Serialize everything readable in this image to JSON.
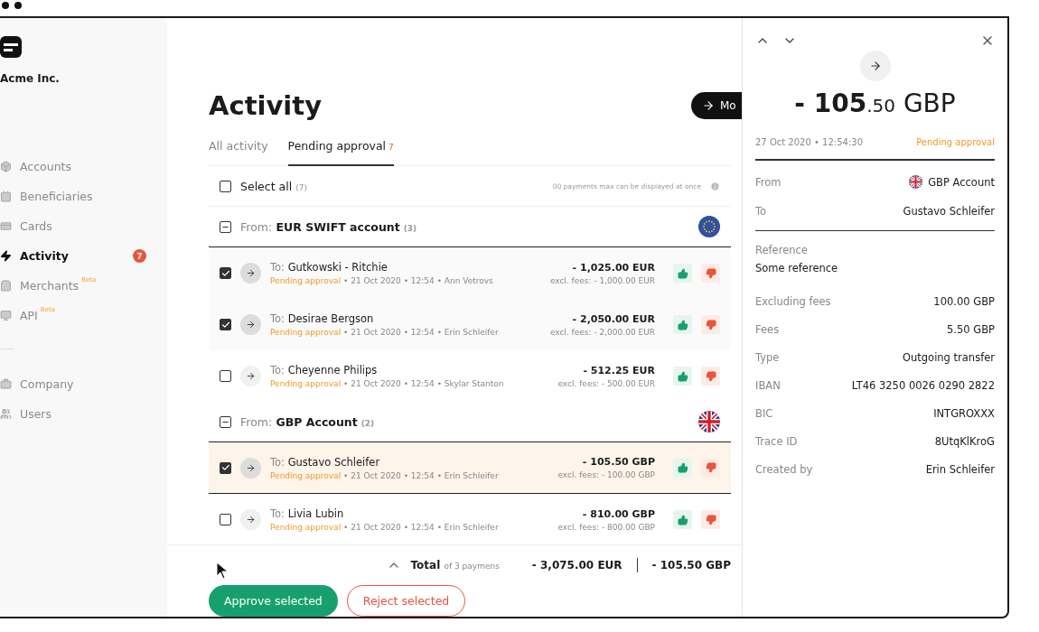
{
  "sidebar": {
    "company": "Acme Inc.",
    "items": [
      {
        "label": "Accounts",
        "selected": false
      },
      {
        "label": "Beneficiaries",
        "selected": false
      },
      {
        "label": "Cards",
        "selected": false
      },
      {
        "label": "Activity",
        "selected": true,
        "badge": "7"
      },
      {
        "label": "Merchants",
        "selected": false,
        "tag": "Beta"
      },
      {
        "label": "API",
        "selected": false,
        "tag": "Beta"
      }
    ],
    "bottom_items": [
      {
        "label": "Company",
        "selected": false
      },
      {
        "label": "Users",
        "selected": false
      }
    ]
  },
  "main": {
    "title": "Activity",
    "action_button": "Mo",
    "tabs": [
      {
        "label": "All activity",
        "selected": false
      },
      {
        "label": "Pending approval",
        "count": "7",
        "selected": true
      }
    ],
    "select_all": {
      "label": "Select all",
      "count": "(7)",
      "checked": false
    },
    "notice": "00 payments max can be displayed at once",
    "groups": [
      {
        "prefix": "From:",
        "name": "EUR SWIFT account",
        "count": "(3)",
        "kind": "eu",
        "expanded": true,
        "rows": [
          {
            "prefix": "To:",
            "name": "Gutkowski - Ritchie",
            "status": "Pending approval",
            "meta": "• 21 Oct 2020 • 12:54 • Ann Vetrovs",
            "amount": "- 1,025.00 EUR",
            "excl": "excl. fees: - 1,000.00 EUR",
            "checked": true,
            "selected": false
          },
          {
            "prefix": "To:",
            "name": "Desirae Bergson",
            "status": "Pending approval",
            "meta": "• 21 Oct 2020 • 12:54 • Erin Schleifer",
            "amount": "- 2,050.00 EUR",
            "excl": "excl. fees: - 2,000.00 EUR",
            "checked": true,
            "selected": false
          },
          {
            "prefix": "To:",
            "name": "Cheyenne Philips",
            "status": "Pending approval",
            "meta": "• 21 Oct 2020 • 12:54 • Skylar Stanton",
            "amount": "- 512.25 EUR",
            "excl": "excl. fees: - 500.00 EUR",
            "checked": false,
            "selected": false
          }
        ]
      },
      {
        "prefix": "From:",
        "name": "GBP Account",
        "count": "(2)",
        "kind": "uk",
        "expanded": true,
        "rows": [
          {
            "prefix": "To:",
            "name": "Gustavo Schleifer",
            "status": "Pending approval",
            "meta": "• 21 Oct 2020 • 12:54 • Erin Schleifer",
            "amount": "- 105.50 GBP",
            "excl": "excl. fees: - 100.00 GBP",
            "checked": true,
            "selected": true
          },
          {
            "prefix": "To:",
            "name": "Livia Lubin",
            "status": "Pending approval",
            "meta": "• 21 Oct 2020 • 12:54 • Erin Schleifer",
            "amount": "- 810.00 GBP",
            "excl": "excl. fees: - 800.00 GBP",
            "checked": false,
            "selected": false
          }
        ]
      }
    ],
    "footer": {
      "total": "Total",
      "total_note": "of 3 paymens",
      "amounts": [
        "- 3,075.00 EUR",
        "- 105.50 GBP"
      ],
      "approve": "Approve selected",
      "reject": "Reject selected"
    }
  },
  "detail": {
    "amount_whole": "- 105",
    "amount_decimals": ".50",
    "currency": "GBP",
    "datetime": "27 Oct 2020 • 12:54:30",
    "status": "Pending approval",
    "parties": [
      {
        "label": "From",
        "value": "GBP Account",
        "kind": "uk"
      },
      {
        "label": "To",
        "value": "Gustavo Schleifer",
        "kind": "plain"
      }
    ],
    "reference_label": "Reference",
    "reference": "Some reference",
    "fields": [
      {
        "label": "Excluding fees",
        "value": "100.00 GBP"
      },
      {
        "label": "Fees",
        "value": "5.50 GBP"
      },
      {
        "label": "Type",
        "value": "Outgoing transfer"
      },
      {
        "label": "IBAN",
        "value": "LT46 3250 0026 0290 2822"
      },
      {
        "label": "BIC",
        "value": "INTGROXXX"
      },
      {
        "label": "Trace ID",
        "value": "8UtqKlKroG"
      },
      {
        "label": "Created by",
        "value": "Erin Schleifer"
      }
    ]
  }
}
